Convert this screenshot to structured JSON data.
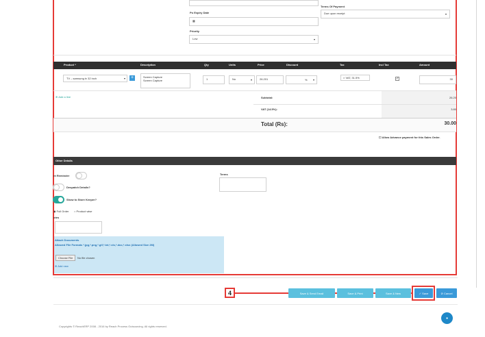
{
  "top_form": {
    "po_expiry_label": "Po Expiry Date",
    "priority_label": "Priority",
    "priority_value": "Low",
    "terms_label": "Terms Of Payment",
    "terms_value": "Due upon receipt"
  },
  "items_table": {
    "headers": [
      "Product *",
      "Description",
      "Qty",
      "Units",
      "Price",
      "Discount",
      "Tax",
      "Incl Tax",
      "Amount"
    ],
    "row": {
      "product": "TV – samsung tv 32 inch",
      "description_line1": "Screen Capture",
      "description_line2": "Screen Capture",
      "qty": "1",
      "units": "No",
      "price": "26.201",
      "discount_unit": "%",
      "tax": "× VAT, 31.5%",
      "amount": "30"
    },
    "add_line_label": "Add a line"
  },
  "totals": {
    "subtotal_label": "Subtotal:",
    "subtotal_value": "26.20",
    "vat_label": "VAT (14.5%):",
    "vat_value": "3.80",
    "total_label": "Total (Rs):",
    "total_value": "30.00",
    "advance_label": "Allow Advance payment for this Sales Order."
  },
  "other_details": {
    "section_title": "Other Details",
    "reminder_label": "nt Reminder",
    "despatch_label": "Despatch Details?",
    "store_keeper_label": "Show to Store Keeper?",
    "full_order_label": "Full Order",
    "product_wise_label": "Product wise",
    "notes_label": "otes",
    "terms_label": "Terms"
  },
  "attachments": {
    "title": "Attach Documents",
    "formats": "Allowed File Formats *.jpg,*.png,*.gif,*.txt,*.xls,*.doc,*.xlsx (Allowed Size 2M)",
    "choose_file_label": "Choose File",
    "no_file_label": "No file chosen",
    "add_new_label": "Add new"
  },
  "actions": {
    "btn1_label": "Save & Send Email",
    "btn2_label": "Save & Print",
    "btn3_label": "Save & New",
    "save_label": "Save",
    "cancel_label": "Cancel"
  },
  "callout_number": "4",
  "footer": "Copyrights © ReachERP 2008 - 2016 by Reach Process Outsourcing. All rights reserved.",
  "colors": {
    "highlight_red": "#e53935",
    "table_header": "#2f2f2f",
    "button_blue": "#3a9ad9",
    "toggle_on": "#26a69a",
    "upload_bg": "#cce7f5"
  }
}
